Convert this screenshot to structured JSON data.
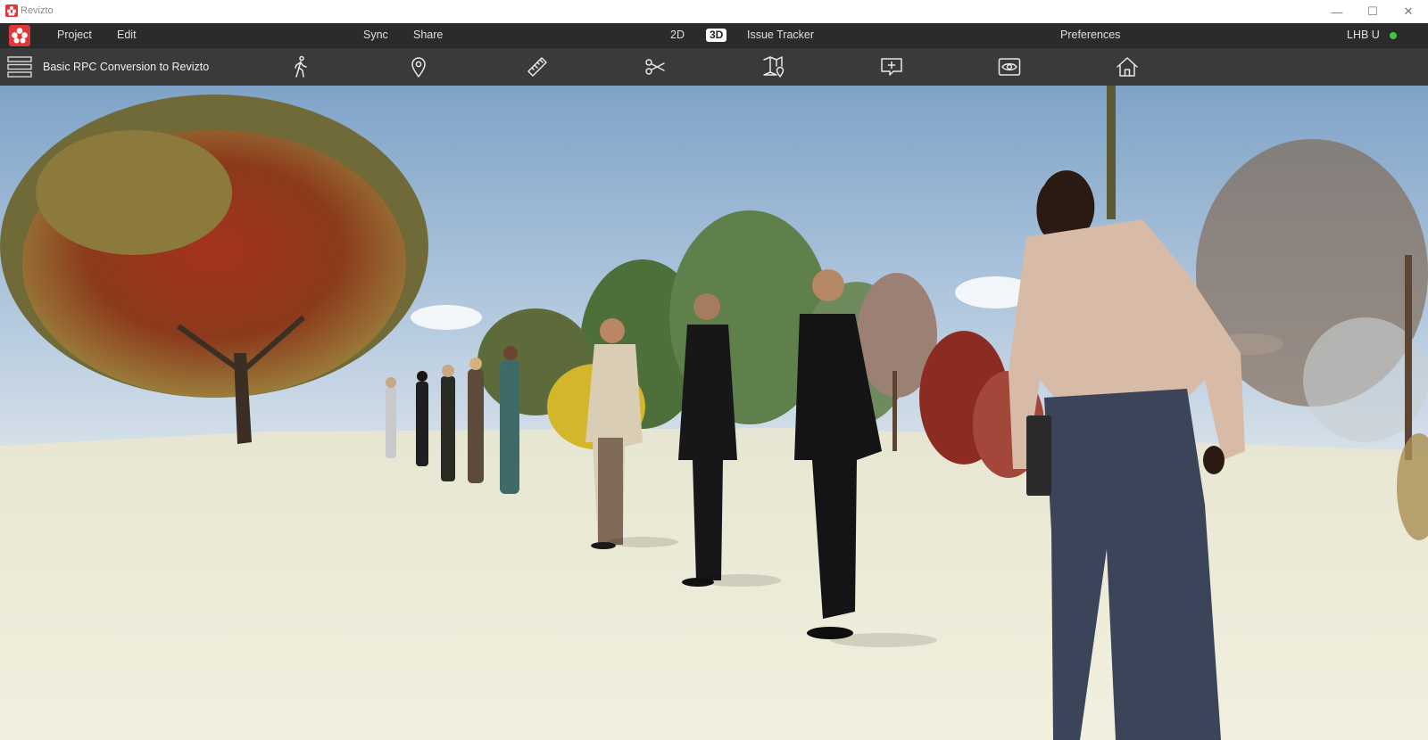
{
  "window": {
    "title": "Revizto",
    "controls": {
      "minimize": "—",
      "maximize": "☐",
      "close": "✕"
    }
  },
  "menu": {
    "project": "Project",
    "edit": "Edit",
    "sync": "Sync",
    "share": "Share",
    "view_2d": "2D",
    "view_3d": "3D",
    "active_view": "3D",
    "issue_tracker": "Issue Tracker",
    "preferences": "Preferences",
    "user": "LHB U",
    "status_color": "#3dc83d"
  },
  "toolbar": {
    "project_name": "Basic RPC Conversion to Revizto",
    "tools": [
      {
        "icon": "walk-icon"
      },
      {
        "icon": "location-pin-icon"
      },
      {
        "icon": "ruler-icon"
      },
      {
        "icon": "scissors-icon"
      },
      {
        "icon": "map-pin-icon"
      },
      {
        "icon": "add-comment-icon"
      },
      {
        "icon": "eye-icon"
      },
      {
        "icon": "home-icon"
      }
    ]
  },
  "colors": {
    "brand": "#e0373a",
    "menubar_bg": "#2b2b2b",
    "toolbar_bg": "#3a3a3a"
  }
}
